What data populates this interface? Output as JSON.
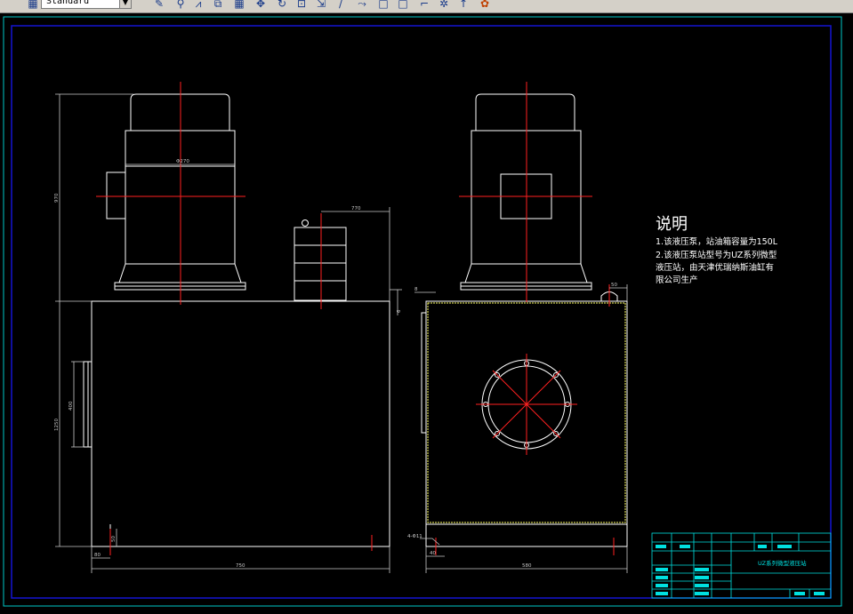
{
  "toolbar": {
    "text_style": "Standard",
    "icons": [
      "layer-icon",
      "eraser-icon",
      "copy-icon",
      "mirror-icon",
      "offset-icon",
      "array-icon",
      "move-icon",
      "rotate-icon",
      "scale-icon",
      "stretch-icon",
      "trim-icon",
      "extend-icon",
      "break-icon",
      "chamfer-icon",
      "fillet-icon",
      "explode-icon",
      "pointer-icon",
      "properties-icon"
    ]
  },
  "drawing": {
    "notes_title": "说明",
    "notes": [
      "1.该液压泵，站油箱容量为150L",
      "2.该液压泵站型号为UZ系列微型",
      "液压站，由天津优瑞纳斯油缸有",
      "限公司生产"
    ],
    "dims": {
      "motor_width": "Φ270",
      "total_height": "970",
      "gauge_offset": "770",
      "tank_height": "1250",
      "window_height": "400",
      "tank_width": "750",
      "side_width": "580",
      "left_margin": "80",
      "bottom_gap": "50",
      "top_gap": "6",
      "foot_dim": "40",
      "side_top": "50",
      "hole_note": "4-Φ11",
      "lid_gap": "8"
    },
    "title_block": {
      "title": "UZ系列微型液压站"
    }
  },
  "colors": {
    "background": "#000000",
    "lines": "#ffffff",
    "centerline": "#ff0000",
    "frame_outer": "#00c8c8",
    "frame_inner": "#1010c8",
    "dims": "#c8c8c8",
    "highlight": "#ffff66",
    "titleblock": "#00e0e0"
  }
}
